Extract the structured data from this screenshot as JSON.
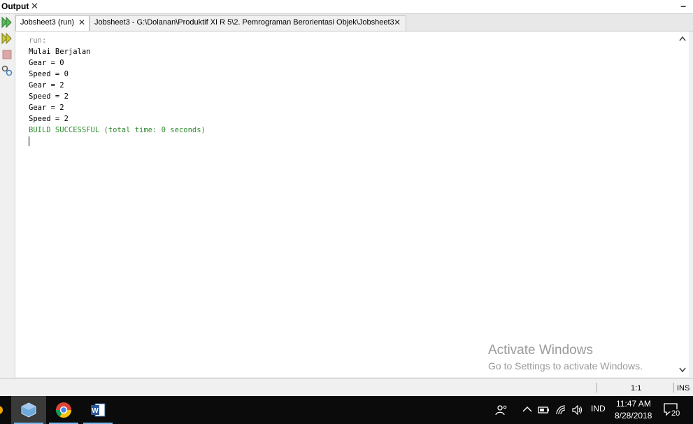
{
  "output_panel": {
    "title": "Output",
    "close_glyph": "✕",
    "minimize_glyph": "–"
  },
  "tabs": [
    {
      "label": "Jobsheet3 (run)",
      "close_glyph": "✕"
    },
    {
      "label": "Jobsheet3 - G:\\Dolanan\\Produktif XI R 5\\2. Pemrograman Berorientasi Objek\\Jobsheet3",
      "close_glyph": "✕"
    }
  ],
  "toolstrip": {
    "icons": [
      "rerun-icon",
      "rerun-with-options-icon",
      "stop-icon",
      "settings-icon"
    ]
  },
  "console": {
    "lines": [
      {
        "text": "run:",
        "style": "gray"
      },
      {
        "text": "Mulai Berjalan",
        "style": "normal"
      },
      {
        "text": "Gear = 0",
        "style": "normal"
      },
      {
        "text": "Speed = 0",
        "style": "normal"
      },
      {
        "text": "Gear = 2",
        "style": "normal"
      },
      {
        "text": "Speed = 2",
        "style": "normal"
      },
      {
        "text": "Gear = 2",
        "style": "normal"
      },
      {
        "text": "Speed = 2",
        "style": "normal"
      },
      {
        "text": "BUILD SUCCESSFUL (total time: 0 seconds)",
        "style": "green"
      }
    ]
  },
  "watermark": {
    "title": "Activate Windows",
    "subtitle": "Go to Settings to activate Windows."
  },
  "statusbar": {
    "position": "1:1",
    "mode": "INS"
  },
  "taskbar": {
    "apps": [
      "virtualbox-icon",
      "chrome-icon",
      "word-icon"
    ],
    "language": "IND",
    "time": "11:47 AM",
    "date": "8/28/2018",
    "notifications": "20"
  },
  "colors": {
    "build_success": "#2e8b2e",
    "run_label": "#8a8a8a",
    "taskbar": "#0b0b0b",
    "taskbar_active_underline": "#76b9ed"
  }
}
